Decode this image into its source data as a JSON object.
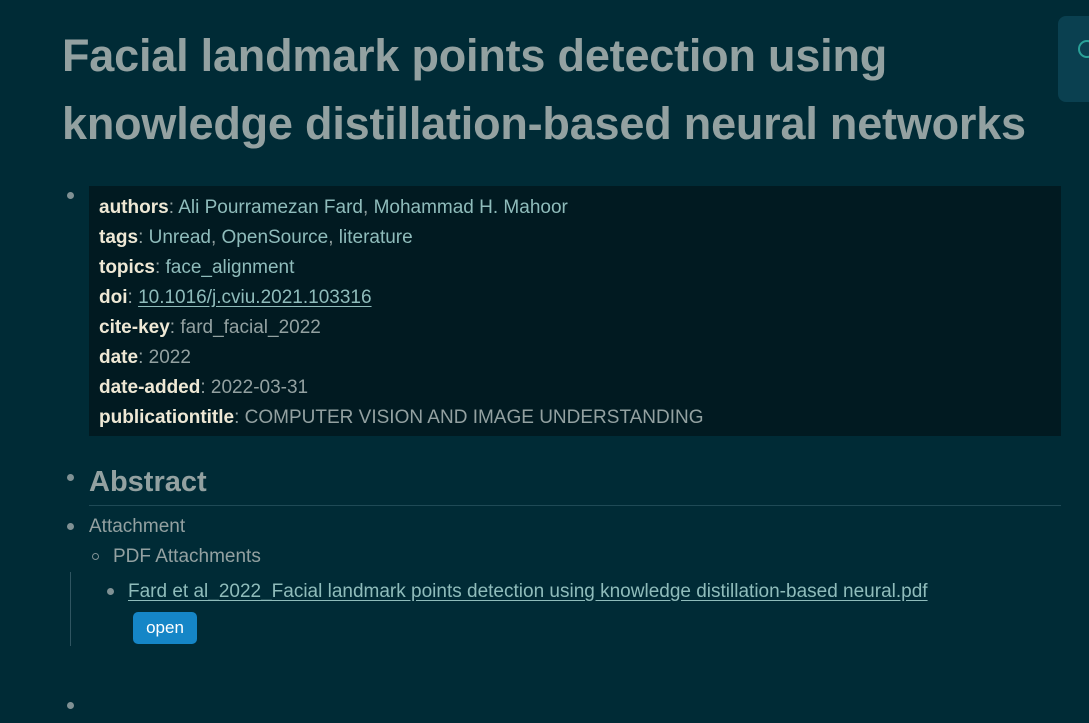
{
  "page": {
    "title": "Facial landmark points detection using knowledge distillation-based neural networks"
  },
  "properties": {
    "authors": {
      "key": "authors",
      "values": [
        "Ali Pourramezan Fard",
        "Mohammad H. Mahoor"
      ]
    },
    "tags": {
      "key": "tags",
      "values": [
        "Unread",
        "OpenSource",
        "literature"
      ]
    },
    "topics": {
      "key": "topics",
      "value": "face_alignment"
    },
    "doi": {
      "key": "doi",
      "value": "10.1016/j.cviu.2021.103316"
    },
    "cite_key": {
      "key": "cite-key",
      "value": "fard_facial_2022"
    },
    "date": {
      "key": "date",
      "value": "2022"
    },
    "date_added": {
      "key": "date-added",
      "value": "2022-03-31"
    },
    "publication_title": {
      "key": "publicationtitle",
      "value": "COMPUTER VISION AND IMAGE UNDERSTANDING"
    },
    "separator": ": ",
    "list_separator": ", "
  },
  "sections": {
    "abstract_heading": "Abstract",
    "attachment_label": "Attachment",
    "pdf_attachments_label": "PDF Attachments",
    "pdf_file_name": "Fard et al_2022_Facial landmark points detection using knowledge distillation-based neural.pdf",
    "open_button_label": "open"
  },
  "colors": {
    "background": "#002b36",
    "property_block": "#011a21",
    "link": "#8fbcbb",
    "button": "#1586c7"
  }
}
